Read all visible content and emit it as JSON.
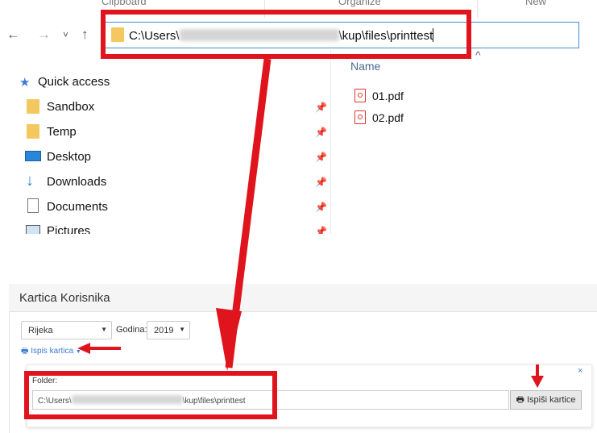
{
  "explorer": {
    "ribbon": {
      "clipboard": "Clipboard",
      "organize": "Organize",
      "new": "New"
    },
    "nav": {
      "back": "←",
      "forward": "→",
      "recent": "˅",
      "up": "↑"
    },
    "address": {
      "prefix": "C:\\Users\\",
      "suffix": "\\kup\\files\\printtest"
    },
    "column_header": "Name",
    "sort_glyph": "^",
    "sidebar": {
      "quick_access": "Quick access",
      "items": [
        {
          "label": "Sandbox",
          "icon": "folder-icon"
        },
        {
          "label": "Temp",
          "icon": "folder-icon"
        },
        {
          "label": "Desktop",
          "icon": "desktop-icon"
        },
        {
          "label": "Downloads",
          "icon": "download-icon"
        },
        {
          "label": "Documents",
          "icon": "document-icon"
        },
        {
          "label": "Pictures",
          "icon": "pictures-icon"
        }
      ]
    },
    "files": [
      {
        "name": "01.pdf",
        "icon": "pdf-icon"
      },
      {
        "name": "02.pdf",
        "icon": "pdf-icon"
      }
    ]
  },
  "web": {
    "panel_title": "Kartica Korisnika",
    "city_select": "Rijeka",
    "year_label": "Godina:",
    "year_select": "2019",
    "print_link": "Ispis kartica",
    "folder_label": "Folder:",
    "folder_prefix": "C:\\Users\\",
    "folder_suffix": "\\kup\\files\\printtest",
    "print_button": "Ispiši kartice",
    "close": "×"
  },
  "colors": {
    "highlight": "#e0141c",
    "link": "#3a7bd5",
    "folder": "#f4c860"
  }
}
